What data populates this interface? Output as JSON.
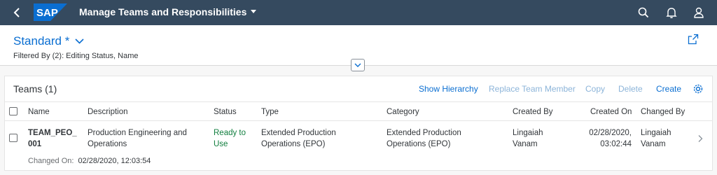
{
  "shell": {
    "app_title": "Manage Teams and Responsibilities",
    "logo_text": "SAP",
    "colors": {
      "bar": "#354a5f",
      "logo": "#0a6ed1"
    }
  },
  "header": {
    "variant": "Standard *",
    "filtered_by": "Filtered By (2): Editing Status, Name"
  },
  "table": {
    "title": "Teams (1)",
    "actions": {
      "show_hierarchy": "Show Hierarchy",
      "replace_team_member": "Replace Team Member",
      "copy": "Copy",
      "delete": "Delete",
      "create": "Create"
    },
    "columns": {
      "name": "Name",
      "description": "Description",
      "status": "Status",
      "type": "Type",
      "category": "Category",
      "created_by": "Created By",
      "created_on": "Created On",
      "changed_by": "Changed By"
    },
    "rows": [
      {
        "name_l1": "TEAM_PEO_",
        "name_l2": "001",
        "description_l1": "Production Engineering and",
        "description_l2": "Operations",
        "status_l1": "Ready to",
        "status_l2": "Use",
        "type_l1": "Extended Production",
        "type_l2": "Operations (EPO)",
        "category_l1": "Extended Production",
        "category_l2": "Operations (EPO)",
        "created_by_l1": "Lingaiah",
        "created_by_l2": "Vanam",
        "created_on_l1": "02/28/2020,",
        "created_on_l2": "03:02:44",
        "changed_by_l1": "Lingaiah",
        "changed_by_l2": "Vanam",
        "changed_on_label": "Changed On:",
        "changed_on_value": "02/28/2020, 12:03:54"
      }
    ]
  }
}
